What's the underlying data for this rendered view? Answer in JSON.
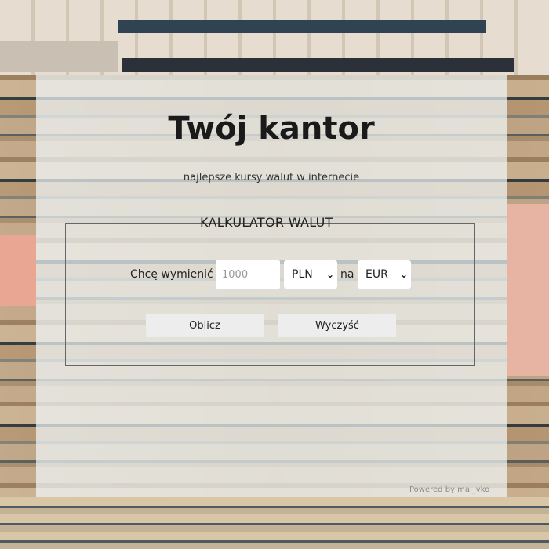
{
  "header": {
    "title": "Twój kantor",
    "subtitle": "najlepsze kursy walut w internecie"
  },
  "calculator": {
    "legend": "KALKULATOR WALUT",
    "label": "Chcę wymienić",
    "amount_placeholder": "1000",
    "from_currency": "PLN",
    "connector": "na",
    "to_currency": "EUR",
    "calculate_label": "Oblicz",
    "clear_label": "Wyczyść"
  },
  "footer": {
    "powered_by": "Powered by mal_vko"
  },
  "icons": {
    "dropdown": "chevron-down-icon"
  }
}
